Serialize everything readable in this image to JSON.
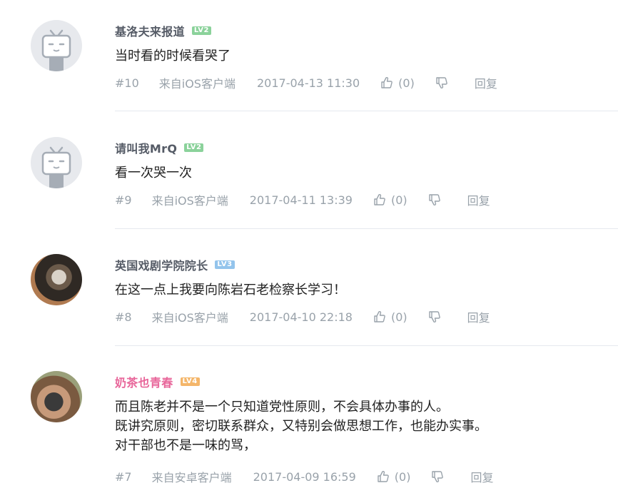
{
  "comments": [
    {
      "username": "基洛夫来报道",
      "level": "LV2",
      "content": [
        "当时看的时候看哭了"
      ],
      "floor": "#10",
      "source": "来自iOS客户端",
      "time": "2017-04-13 11:30",
      "likes": "(0)",
      "reply_label": "回复"
    },
    {
      "username": "请叫我MrQ",
      "level": "LV2",
      "content": [
        "看一次哭一次"
      ],
      "floor": "#9",
      "source": "来自iOS客户端",
      "time": "2017-04-11 13:39",
      "likes": "(0)",
      "reply_label": "回复"
    },
    {
      "username": "英国戏剧学院院长",
      "level": "LV3",
      "content": [
        "在这一点上我要向陈岩石老检察长学习！"
      ],
      "floor": "#8",
      "source": "来自iOS客户端",
      "time": "2017-04-10 22:18",
      "likes": "(0)",
      "reply_label": "回复"
    },
    {
      "username": "奶茶也青春",
      "level": "LV4",
      "content": [
        "而且陈老并不是一个只知道党性原则，不会具体办事的人。",
        "既讲究原则，密切联系群众，又特别会做思想工作，也能办实事。",
        "对干部也不是一味的骂，"
      ],
      "floor": "#7",
      "source": "来自安卓客户端",
      "time": "2017-04-09 16:59",
      "likes": "(0)",
      "reply_label": "回复"
    }
  ],
  "colors": {
    "meta_gray": "#99a2aa",
    "username_gray": "#555b66",
    "username_pink": "#e8669a",
    "lv2": "#8bd29b",
    "lv3": "#93c4ec",
    "lv4": "#f4b66a"
  },
  "icons": {
    "like": "thumbs-up-icon",
    "dislike": "thumbs-down-icon",
    "default_avatar": "tv-face-icon"
  }
}
